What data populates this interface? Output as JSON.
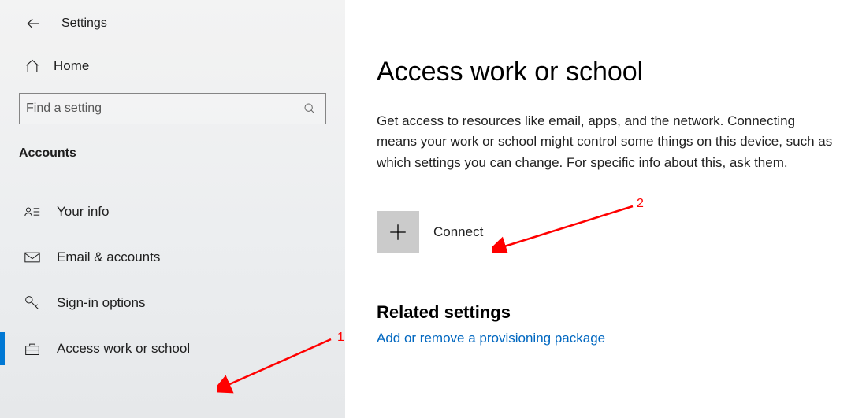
{
  "header": {
    "title": "Settings"
  },
  "sidebar": {
    "home_label": "Home",
    "search_placeholder": "Find a setting",
    "section_label": "Accounts",
    "items": [
      {
        "label": "Your info",
        "icon": "person-card-icon",
        "active": false
      },
      {
        "label": "Email & accounts",
        "icon": "mail-icon",
        "active": false
      },
      {
        "label": "Sign-in options",
        "icon": "key-icon",
        "active": false
      },
      {
        "label": "Access work or school",
        "icon": "briefcase-icon",
        "active": true
      }
    ]
  },
  "main": {
    "heading": "Access work or school",
    "description": "Get access to resources like email, apps, and the network. Connecting means your work or school might control some things on this device, such as which settings you can change. For specific info about this, ask them.",
    "connect_label": "Connect",
    "related_heading": "Related settings",
    "link_provisioning": "Add or remove a provisioning package"
  },
  "annotations": {
    "marker1": "1",
    "marker2": "2"
  }
}
